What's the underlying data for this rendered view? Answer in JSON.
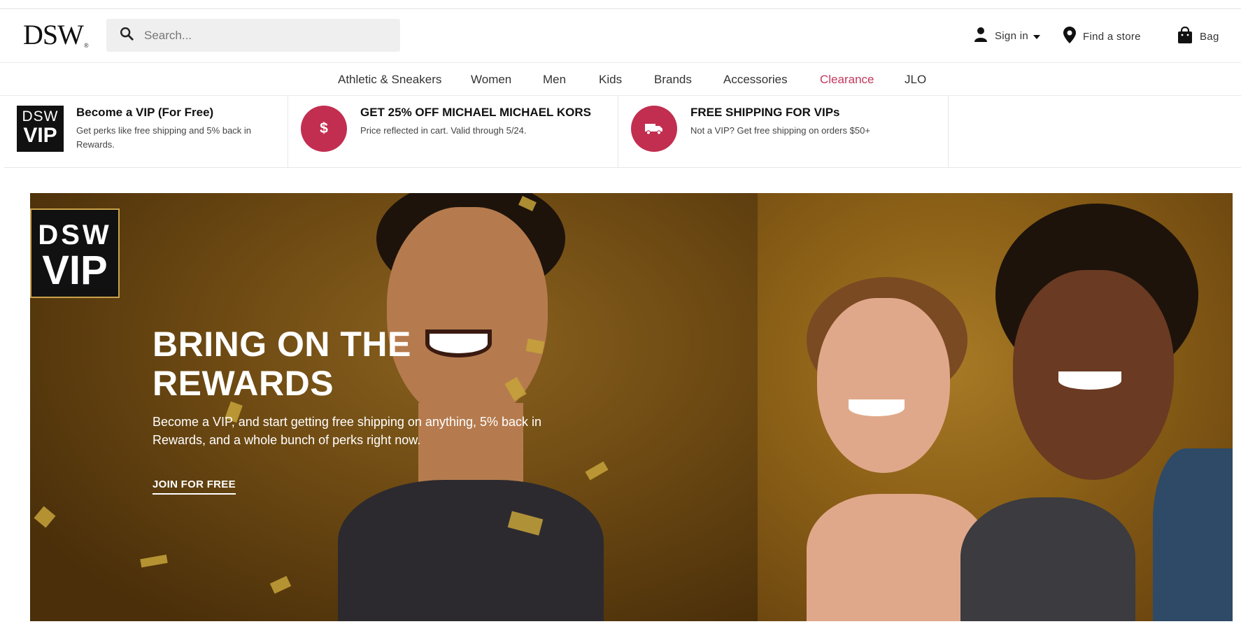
{
  "header": {
    "logo_text": "DSW",
    "logo_mark": "®",
    "search_placeholder": "Search...",
    "sign_in": "Sign in",
    "find_store": "Find a store",
    "bag": "Bag"
  },
  "nav": {
    "items": [
      "Athletic & Sneakers",
      "Women",
      "Men",
      "Kids",
      "Brands",
      "Accessories",
      "Clearance",
      "JLO"
    ]
  },
  "promos": [
    {
      "badge_line1": "DSW",
      "badge_line2": "VIP",
      "title": "Become a VIP (For Free)",
      "desc": "Get perks like free shipping and 5% back in Rewards."
    },
    {
      "icon": "dollar-icon",
      "icon_glyph": "$",
      "title": "GET 25% OFF MICHAEL MICHAEL KORS",
      "desc": "Price reflected in cart. Valid through 5/24."
    },
    {
      "icon": "truck-icon",
      "title": "FREE SHIPPING FOR VIPs",
      "desc": "Not a VIP? Get free shipping on orders $50+"
    }
  ],
  "hero": {
    "tile_line1": "DSW",
    "tile_line2": "VIP",
    "headline": "BRING ON THE REWARDS",
    "subtext": "Become a VIP, and start getting free shipping on anything, 5% back in Rewards, and a whole bunch of perks right now.",
    "cta": "JOIN FOR FREE"
  },
  "colors": {
    "accent": "#c22e50",
    "clearance": "#c4385c",
    "hero_gold": "#8a621f"
  }
}
